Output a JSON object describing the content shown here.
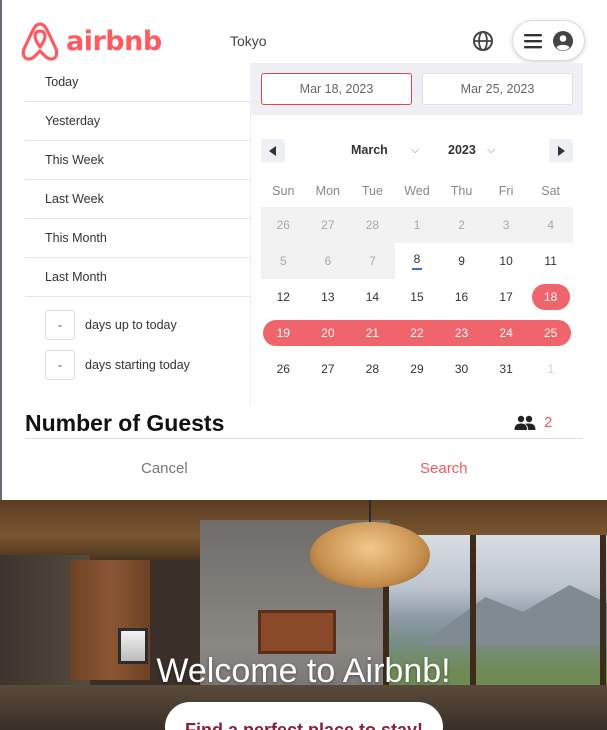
{
  "header": {
    "logo_text": "airbnb",
    "location": "Tokyo",
    "icons": [
      "airbnb-logo-icon",
      "globe-icon",
      "hamburger-icon",
      "user-avatar-icon"
    ]
  },
  "presets": {
    "items": [
      "Today",
      "Yesterday",
      "This Week",
      "Last Week",
      "This Month",
      "Last Month"
    ],
    "ranges": [
      {
        "value": "-",
        "label": "days up to today"
      },
      {
        "value": "-",
        "label": "days starting today"
      }
    ]
  },
  "date_range": {
    "start": "Mar 18, 2023",
    "end": "Mar 25, 2023"
  },
  "calendar": {
    "month": "March",
    "year": "2023",
    "weekdays": [
      "Sun",
      "Mon",
      "Tue",
      "Wed",
      "Thu",
      "Fri",
      "Sat"
    ],
    "weeks": [
      [
        "26",
        "27",
        "28",
        "1",
        "2",
        "3",
        "4"
      ],
      [
        "5",
        "6",
        "7",
        "8",
        "9",
        "10",
        "11"
      ],
      [
        "12",
        "13",
        "14",
        "15",
        "16",
        "17",
        "18"
      ],
      [
        "19",
        "20",
        "21",
        "22",
        "23",
        "24",
        "25"
      ],
      [
        "26",
        "27",
        "28",
        "29",
        "30",
        "31",
        "1"
      ]
    ]
  },
  "guests": {
    "title": "Number of Guests",
    "count": "2"
  },
  "actions": {
    "cancel": "Cancel",
    "search": "Search"
  },
  "hero": {
    "title": "Welcome to Airbnb!",
    "button": "Find a perfect place to stay!"
  },
  "colors": {
    "brand": "#ff5a5f",
    "selection": "#f0646b",
    "today_underline": "#2b73d9"
  }
}
